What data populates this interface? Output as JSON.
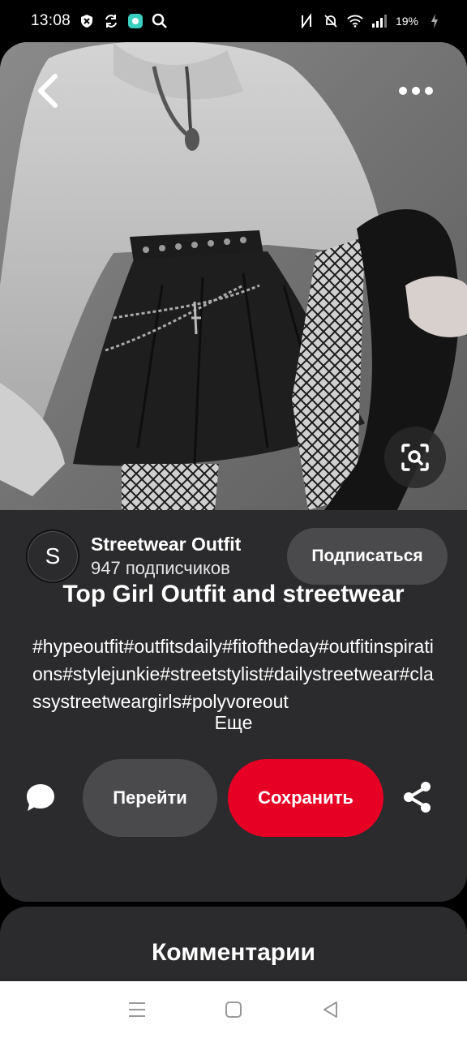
{
  "status_bar": {
    "time": "13:08",
    "battery": "19%",
    "left_icons": [
      "shield-icon",
      "sync-icon",
      "app-icon",
      "search-icon"
    ],
    "right_icons": [
      "nfc-icon",
      "mute-icon",
      "wifi-icon",
      "signal-icon",
      "battery-icon"
    ]
  },
  "pin": {
    "image_description_icon": "photo",
    "creator": {
      "avatar_letter": "S",
      "name": "Streetwear Outfit",
      "followers": "947 подписчиков",
      "follow_label": "Подписаться"
    },
    "title": "Top Girl Outfit and streetwear",
    "description": "#hypeoutfit#outfitsdaily#fitoftheday#outfitinspirations#stylejunkie#streetstylist#dailystreetwear#classystreetweargirls#polyvoreout",
    "more_label": "Еще",
    "actions": {
      "visit_label": "Перейти",
      "save_label": "Сохранить"
    }
  },
  "comments": {
    "title": "Комментарии"
  },
  "colors": {
    "accent": "#e60023",
    "card_bg": "#2b2a2c",
    "button_bg": "#4a494c"
  }
}
